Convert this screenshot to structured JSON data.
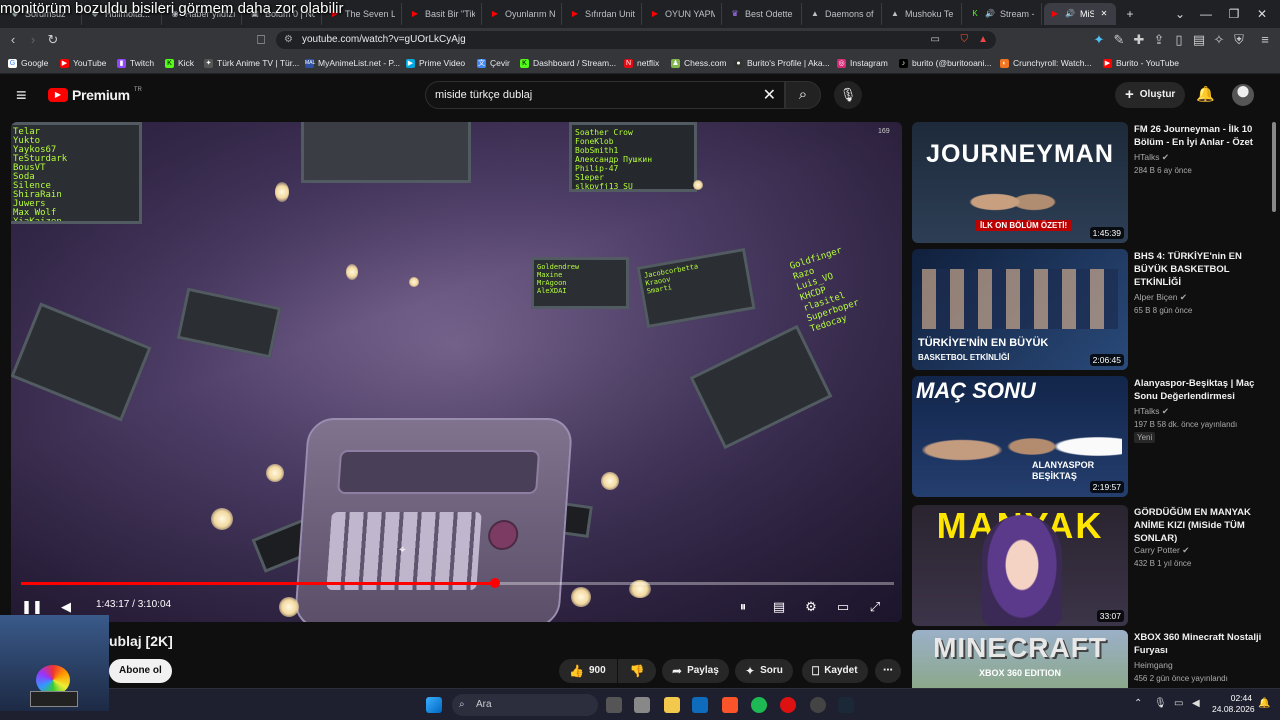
{
  "overlay_text": "monitörüm bozuldu bisileri görmem daha zor olabilir",
  "tabs": [
    {
      "label": "Sorumsuz"
    },
    {
      "label": "Hullmolta..."
    },
    {
      "label": "Haber yıldızı"
    },
    {
      "label": "Bolum 0 | No"
    },
    {
      "label": "The Seven Le"
    },
    {
      "label": "Basit Bir \"Tik"
    },
    {
      "label": "Oyunlarım N"
    },
    {
      "label": "Sıfırdan Unity"
    },
    {
      "label": "OYUN YAPM"
    },
    {
      "label": "Best Odette"
    },
    {
      "label": "Daemons of"
    },
    {
      "label": "Mushoku Te"
    },
    {
      "label": "Stream -"
    },
    {
      "label": "MiSid"
    }
  ],
  "address": {
    "url": "youtube.com/watch?v=gUOrLkCyAjg"
  },
  "bookmarks": [
    {
      "label": "Google"
    },
    {
      "label": "YouTube"
    },
    {
      "label": "Twitch"
    },
    {
      "label": "Kick"
    },
    {
      "label": "Türk Anime TV | Tür..."
    },
    {
      "label": "MyAnimeList.net - P..."
    },
    {
      "label": "Prime Video"
    },
    {
      "label": "Çevir"
    },
    {
      "label": "Dashboard / Stream..."
    },
    {
      "label": "netflix"
    },
    {
      "label": "Chess.com"
    },
    {
      "label": "Burito's Profile | Aka..."
    },
    {
      "label": "Instagram"
    },
    {
      "label": "burito (@buritooani..."
    },
    {
      "label": "Crunchyroll: Watch..."
    },
    {
      "label": "Burito - YouTube"
    }
  ],
  "yt": {
    "logo": "Premium",
    "logo_sup": "TR",
    "search_query": "miside türkçe dublaj",
    "create_label": "Oluştur"
  },
  "video": {
    "time": "1:43:17 / 3:10:04",
    "progress_fraction": 0.543,
    "title_fragment": "ublaj [2K]",
    "subscribe": "Abone ol",
    "likes": "900",
    "share": "Paylaş",
    "ask": "Soru",
    "save": "Kaydet",
    "overlay_counter": "169"
  },
  "screens": {
    "s1": "Telar\nYukto\nYaykos67\nTeSturdark\nBousVT\nSoda\nSilence\nShiraRain\nJuwers\nMax Wolf\nXiaKaizen",
    "s2": "Soather Crow\nFoneKlob\nBobSmith1\nАлександр Пушкин\nPhilip-47\nS1eper\nslkpvfj13 SU",
    "s3": "Goldfinger\nRazo\nLuis_VO\nKHCDP\nrlasitel\nSuperboper\nTedocay",
    "s4": "Jacobcorbetta\nKraoov\nSmarti",
    "s5": "Goldendrew\nMaxine\nMrAgoon\nAleXDAI"
  },
  "recs": [
    {
      "title": "FM 26 Journeyman - İlk 10 Bölüm - En İyi Anlar - Özet",
      "channel": "HTalks",
      "meta": "284 B  6 ay önce",
      "duration": "1:45:39",
      "thumb_text": "JOURNEYMAN",
      "thumb_sub": "İLK ON BÖLÜM ÖZETİ!"
    },
    {
      "title": "BHS 4: TÜRKİYE'nin EN BÜYÜK BASKETBOL ETKİNLİĞİ",
      "channel": "Alper Biçen",
      "meta": "65 B  8 gün önce",
      "duration": "2:06:45",
      "thumb_text": "TÜRKİYE'NİN EN BÜYÜK",
      "thumb_sub": "BASKETBOL ETKİNLİĞİ"
    },
    {
      "title": "Alanyaspor-Beşiktaş | Maç Sonu Değerlendirmesi",
      "channel": "HTalks",
      "meta": "197 B  58 dk. önce yayınlandı",
      "badge": "Yeni",
      "duration": "2:19:57",
      "thumb_text": "MAÇ SONU",
      "thumb_sub": "ALANYASPOR BEŞİKTAŞ"
    },
    {
      "title": "GÖRDÜĞÜM EN MANYAK ANİME KIZI (MiSide TÜM SONLAR)",
      "channel": "Carry Potter",
      "meta": "432 B  1 yıl önce",
      "duration": "33:07",
      "thumb_text": "MANYAK"
    },
    {
      "title": "XBOX 360 Minecraft Nostalji Furyası",
      "channel": "Heimgang",
      "meta": "456  2 gün önce yayınlandı",
      "thumb_text": "MINECRAFT",
      "thumb_sub": "XBOX 360 EDITION"
    }
  ],
  "taskbar": {
    "search": "Ara",
    "time": "02:44",
    "date": "24.08.2026"
  }
}
